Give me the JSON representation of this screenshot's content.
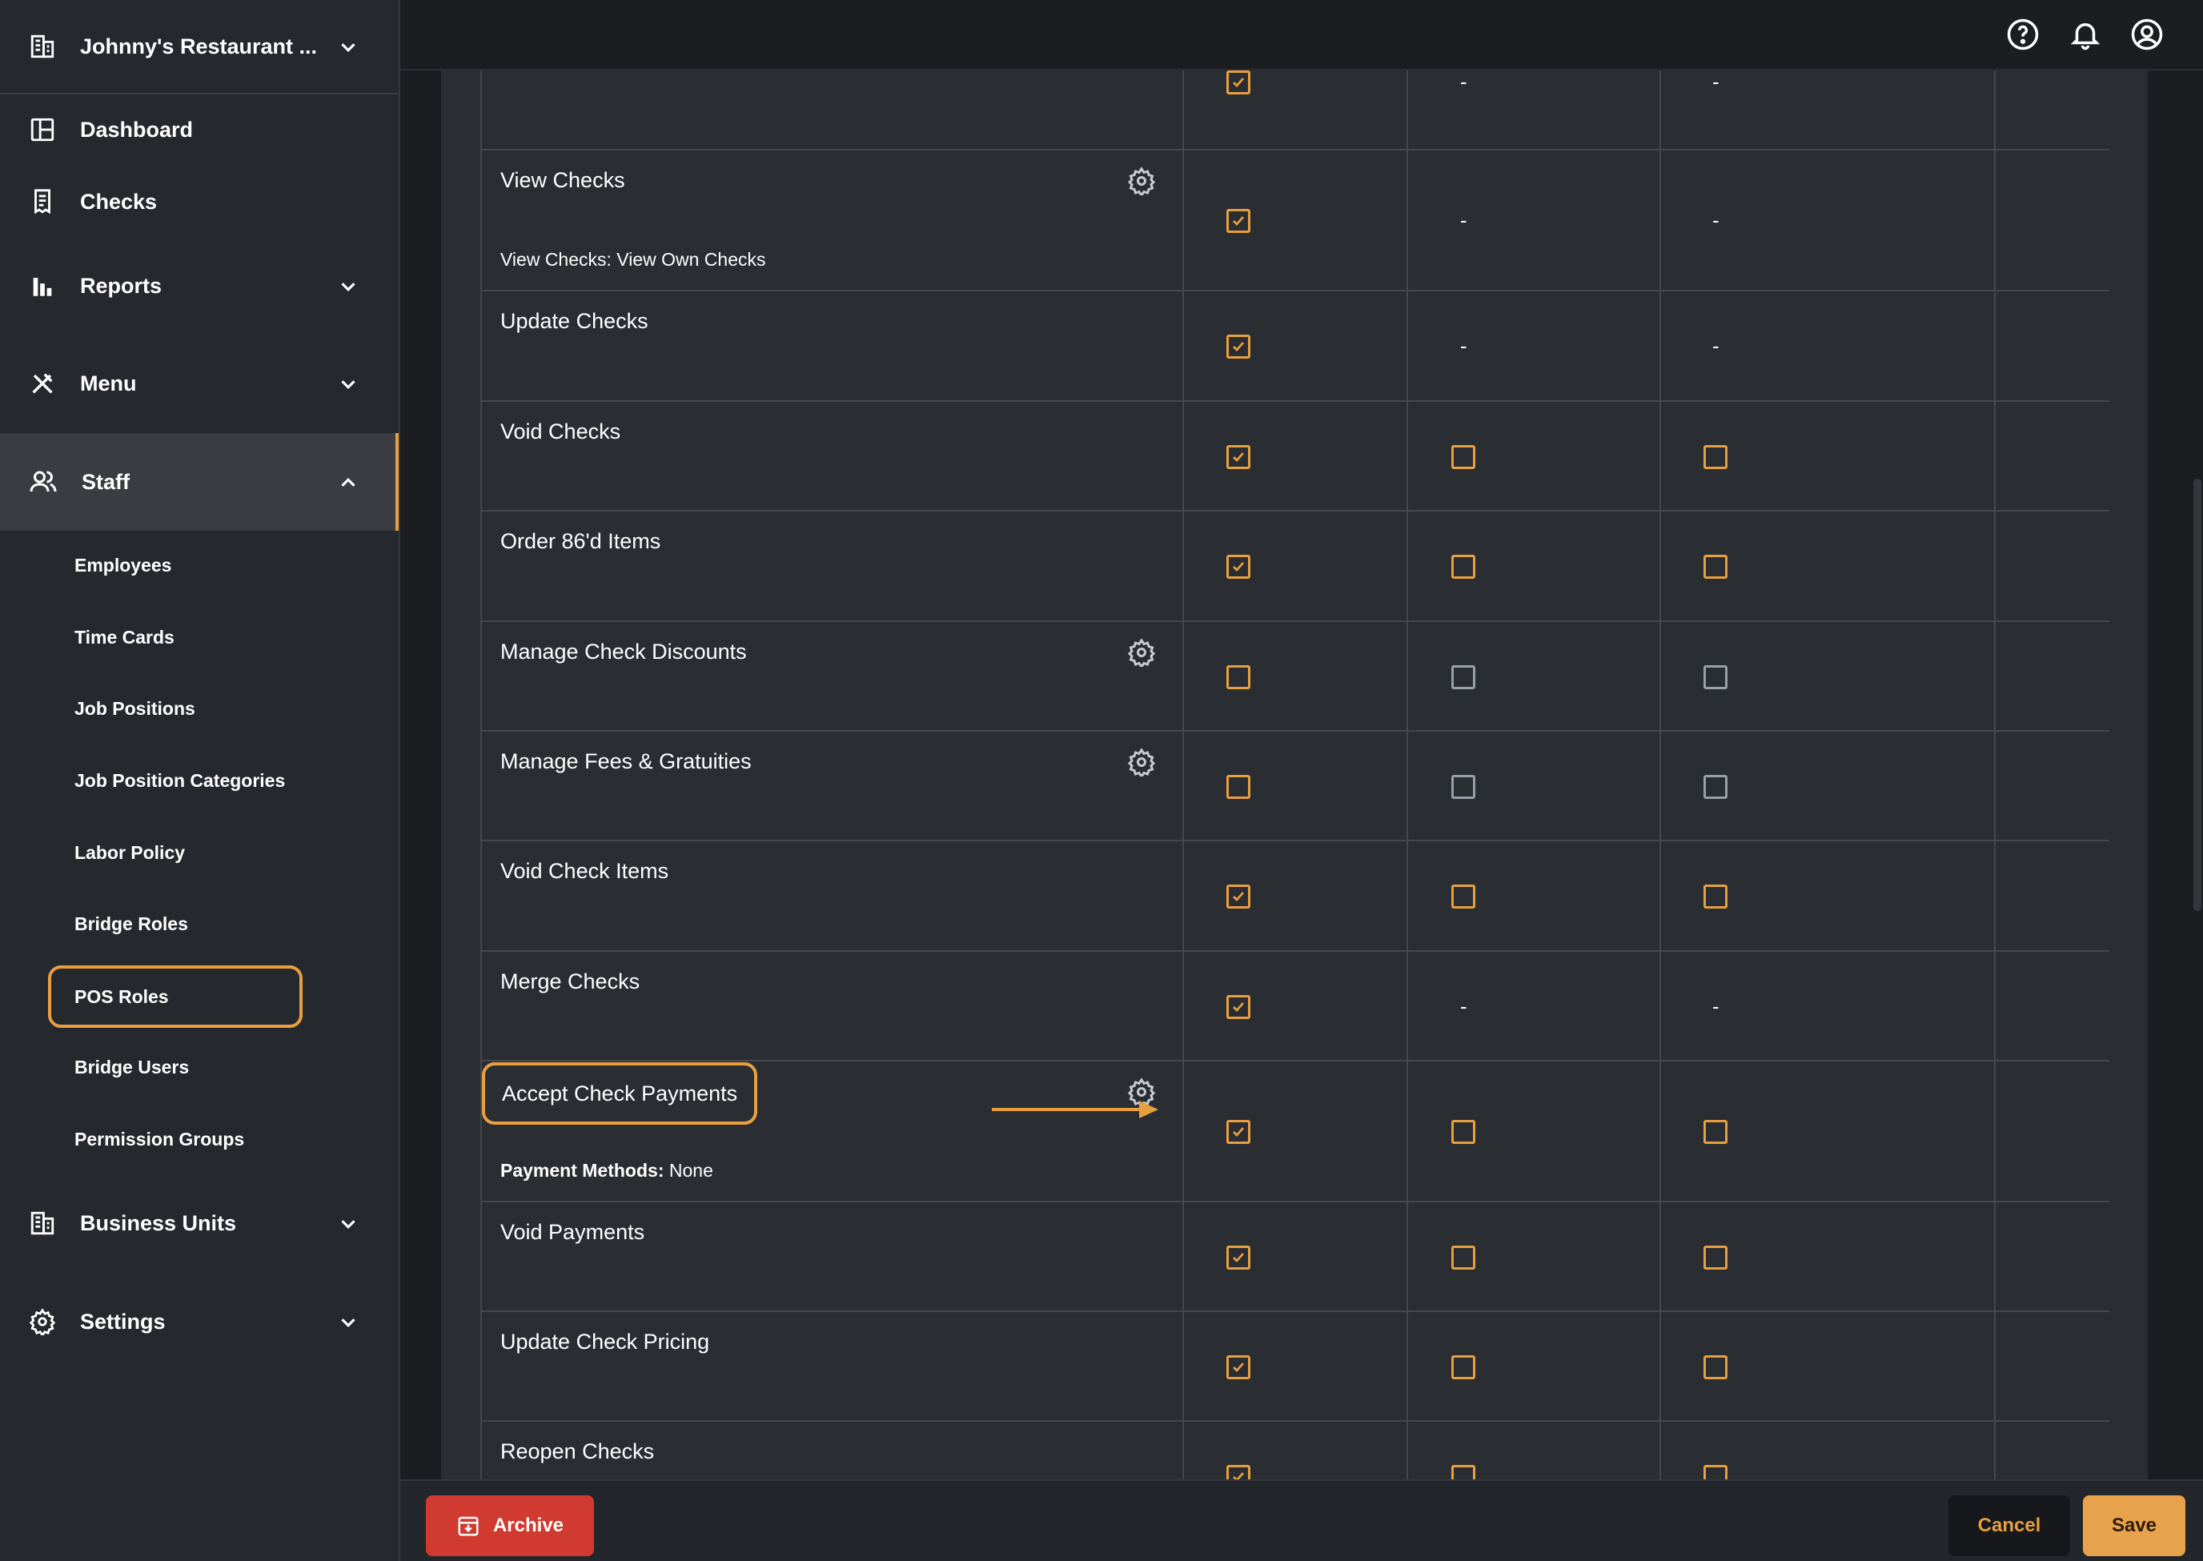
{
  "sidebar": {
    "restaurant_name": "Johnny's Restaurant ...",
    "items": {
      "dashboard": "Dashboard",
      "checks": "Checks",
      "reports": "Reports",
      "menu": "Menu",
      "staff": "Staff",
      "business_units": "Business Units",
      "settings": "Settings"
    },
    "staff_sub": [
      "Employees",
      "Time Cards",
      "Job Positions",
      "Job Position Categories",
      "Labor Policy",
      "Bridge Roles",
      "POS Roles",
      "Bridge Users",
      "Permission Groups"
    ]
  },
  "topbar": {
    "icons": [
      "help-icon",
      "bell-icon",
      "user-icon"
    ]
  },
  "permissions": [
    {
      "name": "",
      "sub": "",
      "gear": false,
      "cols": [
        "checked",
        "dash",
        "dash"
      ]
    },
    {
      "name": "View Checks",
      "sub_label": "",
      "sub": "View Checks: View Own Checks",
      "gear": true,
      "cols": [
        "checked",
        "dash",
        "dash"
      ]
    },
    {
      "name": "Update Checks",
      "sub": "",
      "gear": false,
      "cols": [
        "checked",
        "dash",
        "dash"
      ]
    },
    {
      "name": "Void Checks",
      "sub": "",
      "gear": false,
      "cols": [
        "checked",
        "unchecked",
        "unchecked"
      ]
    },
    {
      "name": "Order 86'd Items",
      "sub": "",
      "gear": false,
      "cols": [
        "checked",
        "unchecked",
        "unchecked"
      ]
    },
    {
      "name": "Manage Check Discounts",
      "sub": "",
      "gear": true,
      "cols": [
        "unchecked",
        "disabled",
        "disabled"
      ]
    },
    {
      "name": "Manage Fees & Gratuities",
      "sub": "",
      "gear": true,
      "cols": [
        "unchecked",
        "disabled",
        "disabled"
      ]
    },
    {
      "name": "Void Check Items",
      "sub": "",
      "gear": false,
      "cols": [
        "checked",
        "unchecked",
        "unchecked"
      ]
    },
    {
      "name": "Merge Checks",
      "sub": "",
      "gear": false,
      "cols": [
        "checked",
        "dash",
        "dash"
      ]
    },
    {
      "name": "Accept Check Payments",
      "sub_label": "Payment Methods:",
      "sub": "None",
      "gear": true,
      "cols": [
        "checked",
        "unchecked",
        "unchecked"
      ]
    },
    {
      "name": "Void Payments",
      "sub": "",
      "gear": false,
      "cols": [
        "checked",
        "unchecked",
        "unchecked"
      ]
    },
    {
      "name": "Update Check Pricing",
      "sub": "",
      "gear": false,
      "cols": [
        "checked",
        "unchecked",
        "unchecked"
      ]
    },
    {
      "name": "Reopen Checks",
      "sub": "",
      "gear": false,
      "cols": [
        "checked",
        "unchecked",
        "unchecked"
      ]
    }
  ],
  "dash_symbol": "-",
  "footer": {
    "archive": "Archive",
    "cancel": "Cancel",
    "save": "Save"
  },
  "colors": {
    "accent": "#e89f3f",
    "danger": "#d13a31",
    "background": "#1b1d21",
    "panel": "#2a2d32",
    "sidebar": "#25282d"
  }
}
